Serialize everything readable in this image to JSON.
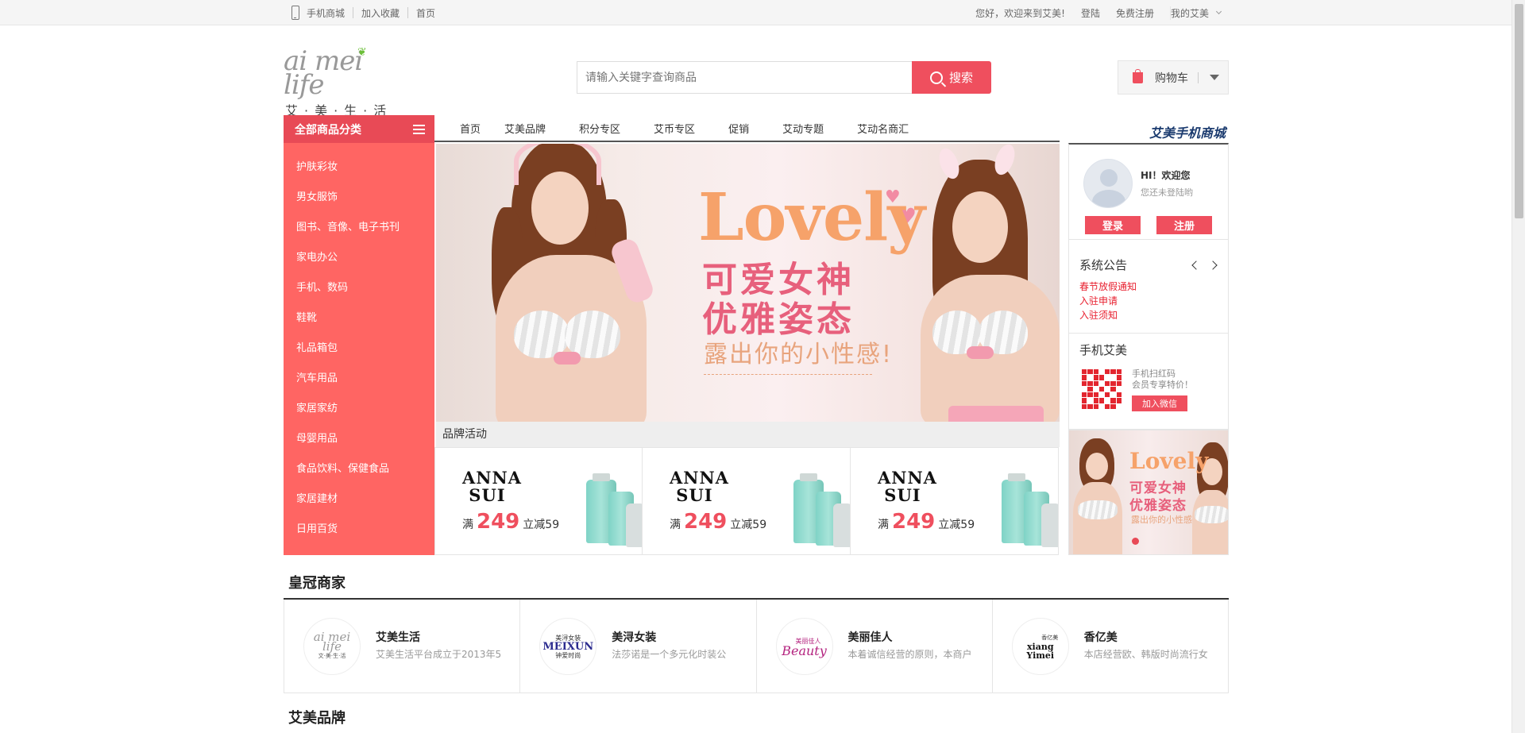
{
  "topbar": {
    "mobile_mall": "手机商城",
    "favorite": "加入收藏",
    "home": "首页",
    "welcome": "您好，欢迎来到艾美!",
    "login": "登陆",
    "register": "免费注册",
    "my_account": "我的艾美"
  },
  "logo": {
    "script": "ai mei life",
    "chinese": "艾·美·生·活"
  },
  "search": {
    "placeholder": "请输入关键字查询商品",
    "button": "搜索"
  },
  "cart": {
    "label": "购物车"
  },
  "categories": {
    "header": "全部商品分类",
    "items": [
      "护肤彩妆",
      "男女服饰",
      "图书、音像、电子书刊",
      "家电办公",
      "手机、数码",
      "鞋靴",
      "礼品箱包",
      "汽车用品",
      "家居家纺",
      "母婴用品",
      "食品饮料、保健食品",
      "家居建材",
      "日用百货"
    ]
  },
  "nav": {
    "items": [
      "首页",
      "艾美品牌",
      "积分专区",
      "艾币专区",
      "促销",
      "艾动专题",
      "艾动名商汇"
    ],
    "mobile_mall": "艾美手机商城"
  },
  "banner": {
    "title": "Lovely",
    "line1": "可爱女神",
    "line2": "优雅姿态",
    "line3": "露出你的小性感!"
  },
  "brand_activity": {
    "title": "品牌活动",
    "cards": [
      {
        "brand": "ANNA SUI",
        "prefix": "满",
        "amount": "249",
        "suffix": "立减59"
      },
      {
        "brand": "ANNA SUI",
        "prefix": "满",
        "amount": "249",
        "suffix": "立减59"
      },
      {
        "brand": "ANNA SUI",
        "prefix": "满",
        "amount": "249",
        "suffix": "立减59"
      }
    ]
  },
  "user_box": {
    "greeting": "HI！欢迎您",
    "status": "您还未登陆哟",
    "login": "登录",
    "register": "注册"
  },
  "notice": {
    "title": "系统公告",
    "items": [
      "春节放假通知",
      "入驻申请",
      "入驻须知"
    ]
  },
  "mobile": {
    "title": "手机艾美",
    "line1": "手机扫红码",
    "line2": "会员专享特价！",
    "button": "加入微信"
  },
  "side_banner": {
    "title": "Lovely",
    "line1": "可爱女神",
    "line2": "优雅姿态",
    "line3": "露出你的小性感"
  },
  "crown": {
    "title": "皇冠商家",
    "merchants": [
      {
        "name": "艾美生活",
        "desc": "艾美生活平台成立于2013年5",
        "logo": "ai mei life",
        "logo_sub": "文·美·生·活"
      },
      {
        "name": "美浔女装",
        "desc": "法莎诺是一个多元化时装公",
        "logo": "MEIXUN",
        "logo_sub": "钟爱时尚",
        "logo_top": "美浔女装"
      },
      {
        "name": "美丽佳人",
        "desc": "本着诚信经营的原则，本商户",
        "logo": "Beauty",
        "logo_top": "美丽佳人"
      },
      {
        "name": "香亿美",
        "desc": "本店经营欧、韩版时尚流行女",
        "logo": "xiang Yimei",
        "logo_top": "香亿美"
      }
    ]
  },
  "brand_section": {
    "title": "艾美品牌"
  },
  "colors": {
    "accent": "#ef4f5e",
    "category_bg": "#ff6563",
    "category_head": "#e84a56",
    "notice_text": "#e8202f",
    "mobile_mall": "#1b3b6f"
  }
}
